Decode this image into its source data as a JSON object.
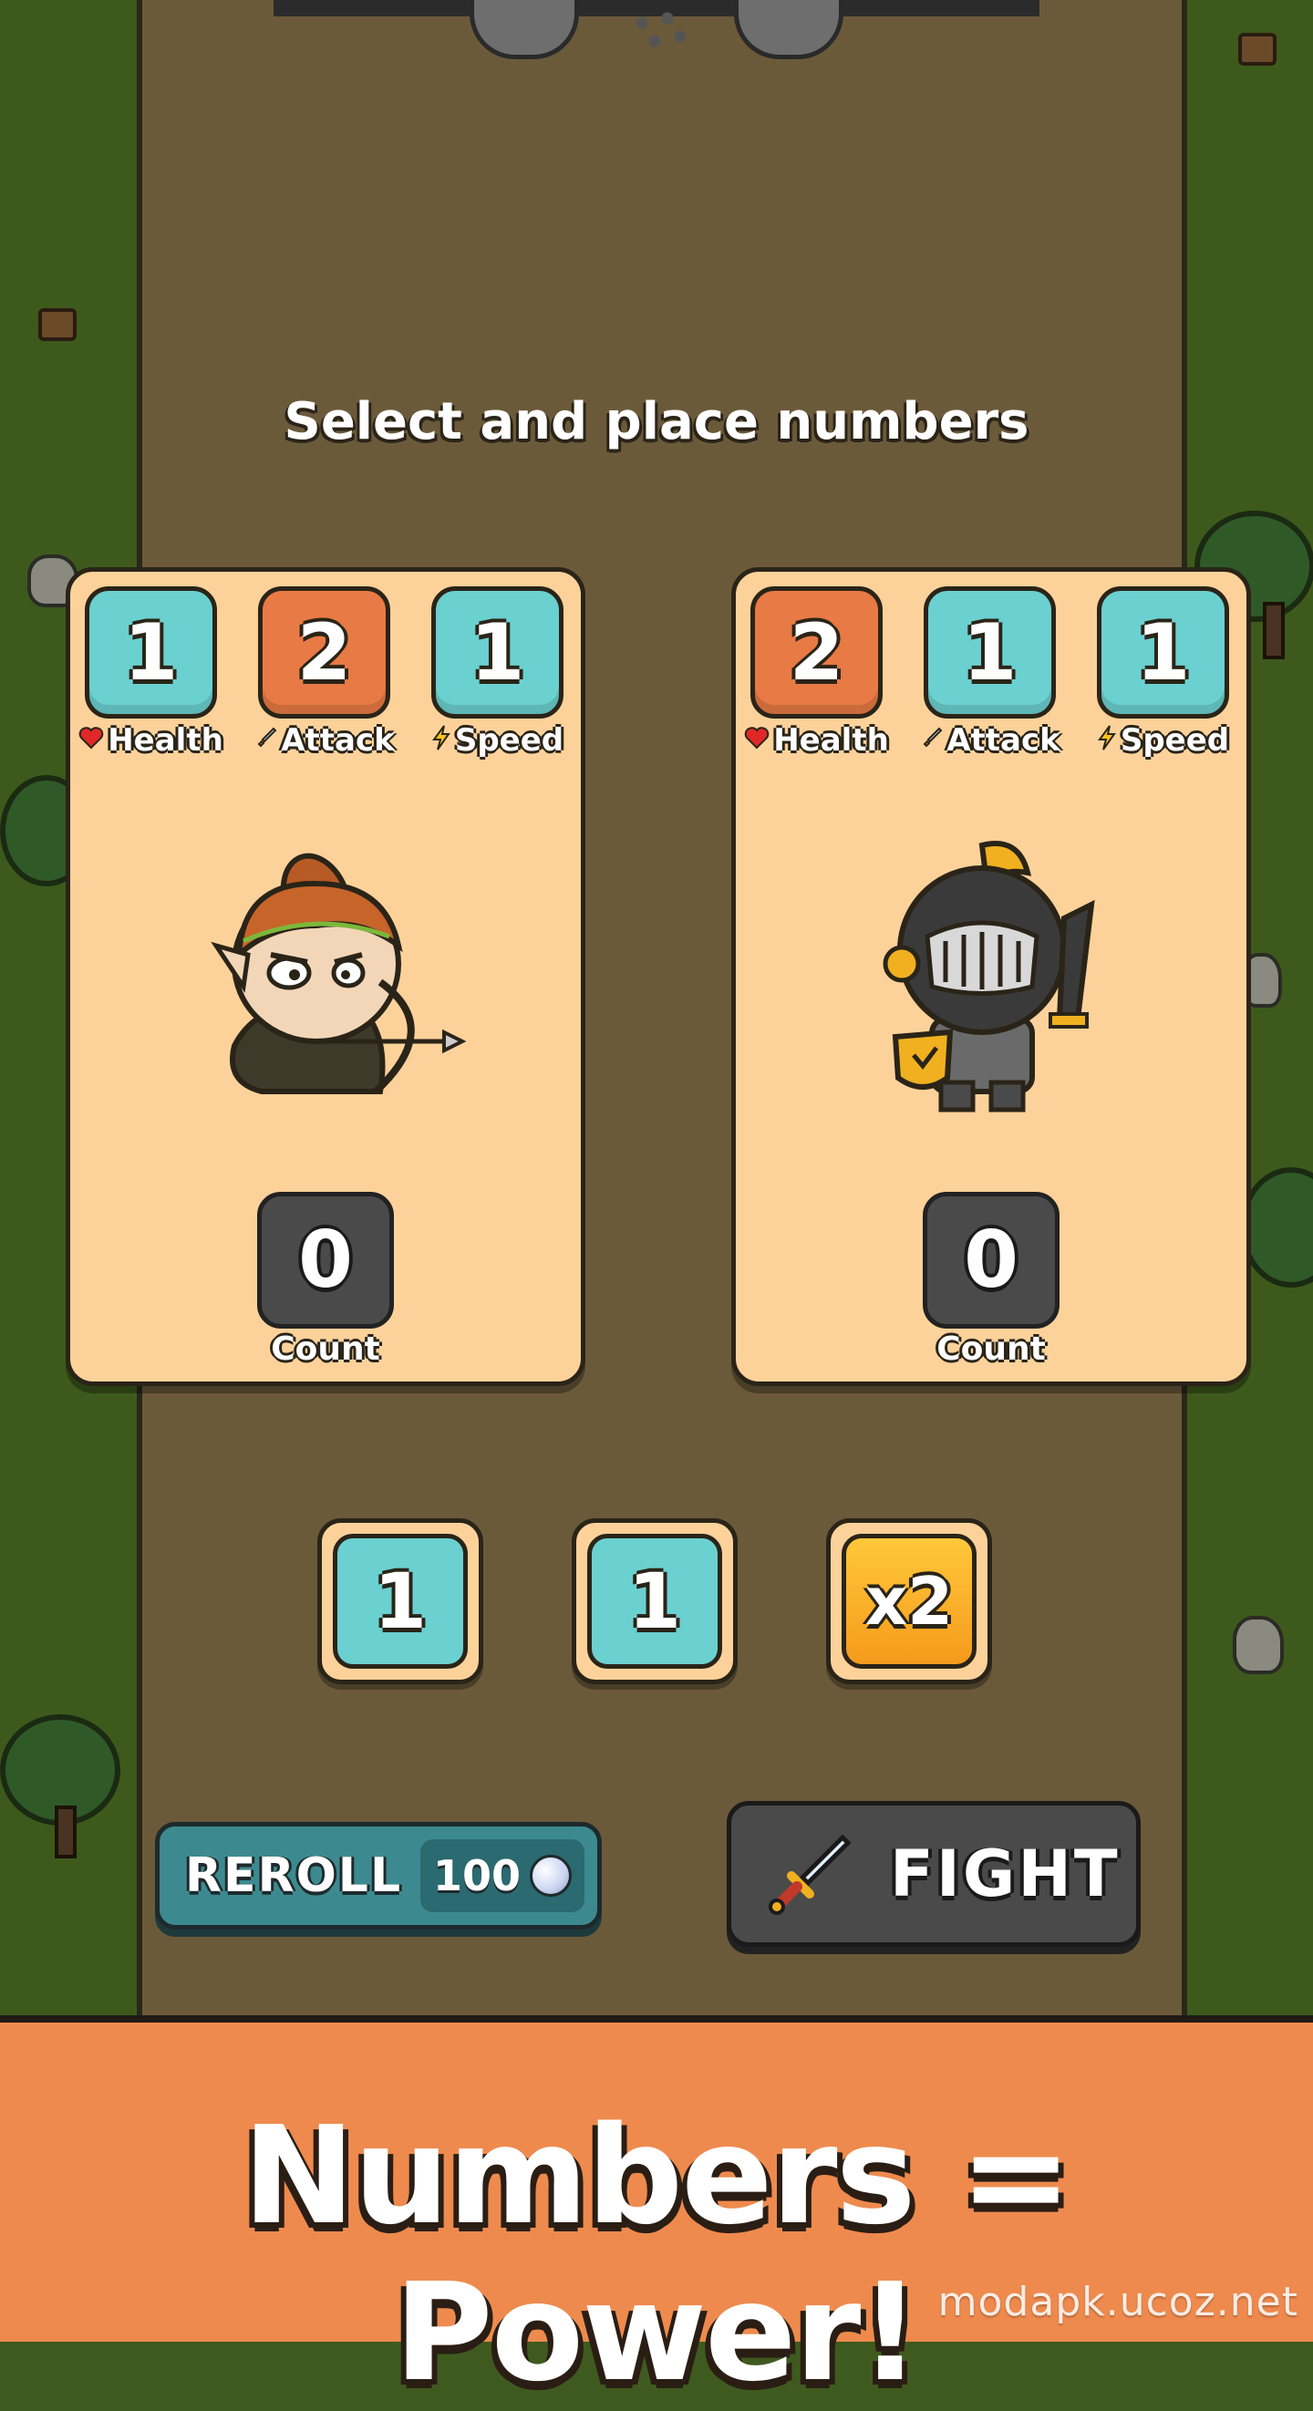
{
  "header": {
    "title": "Select and place numbers"
  },
  "cards": [
    {
      "character": "elf-archer",
      "stats": [
        {
          "value": "1",
          "label": "Health",
          "color": "#6bd0d0",
          "icon": "heart-icon"
        },
        {
          "value": "2",
          "label": "Attack",
          "color": "#e87a45",
          "icon": "sword-icon"
        },
        {
          "value": "1",
          "label": "Speed",
          "color": "#6bd0d0",
          "icon": "lightning-icon"
        }
      ],
      "count": {
        "value": "0",
        "label": "Count"
      }
    },
    {
      "character": "armored-knight",
      "stats": [
        {
          "value": "2",
          "label": "Health",
          "color": "#e87a45",
          "icon": "heart-icon"
        },
        {
          "value": "1",
          "label": "Attack",
          "color": "#6bd0d0",
          "icon": "sword-icon"
        },
        {
          "value": "1",
          "label": "Speed",
          "color": "#6bd0d0",
          "icon": "lightning-icon"
        }
      ],
      "count": {
        "value": "0",
        "label": "Count"
      }
    }
  ],
  "tiles": [
    "1",
    "1",
    "x2"
  ],
  "buttons": {
    "reroll_label": "REROLL",
    "reroll_cost": "100",
    "fight_label": "FIGHT"
  },
  "banner": {
    "text": "Numbers = Power!"
  },
  "watermark": "modapk.ucoz.net",
  "colors": {
    "teal": "#6bd0d0",
    "orange": "#e87a45",
    "card": "#fdd29a",
    "banner": "#ee8a4e",
    "reroll": "#3c8a90",
    "fight": "#4a4a4a"
  }
}
